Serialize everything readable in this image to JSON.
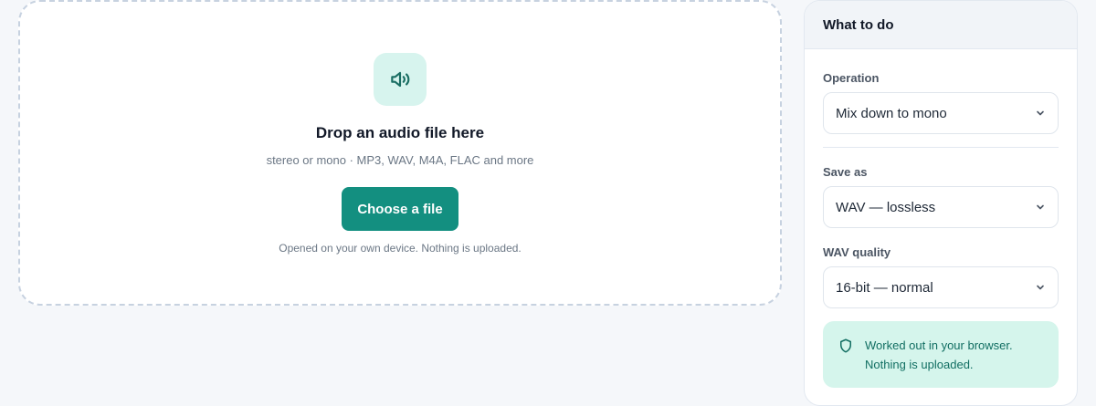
{
  "dropzone": {
    "icon": "speaker-icon",
    "title": "Drop an audio file here",
    "subtitle": "stereo or mono · MP3, WAV, M4A, FLAC and more",
    "button_label": "Choose a file",
    "note": "Opened on your own device. Nothing is uploaded."
  },
  "panel": {
    "title": "What to do",
    "operation": {
      "label": "Operation",
      "value": "Mix down to mono"
    },
    "save_as": {
      "label": "Save as",
      "value": "WAV — lossless"
    },
    "wav_quality": {
      "label": "WAV quality",
      "value": "16-bit — normal"
    },
    "notice": {
      "icon": "shield-icon",
      "line1": "Worked out in your browser.",
      "line2": "Nothing is uploaded."
    }
  },
  "colors": {
    "accent": "#138f80",
    "accent_tint": "#d7f4ee",
    "notice_bg": "#d5f5ec",
    "notice_text": "#116e62",
    "page_bg": "#f5f7fa"
  }
}
